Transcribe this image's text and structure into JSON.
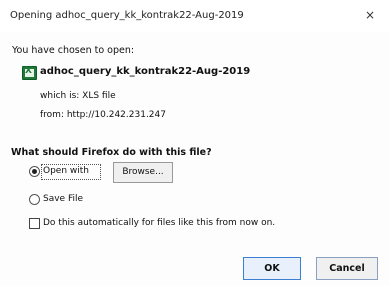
{
  "dialog": {
    "title": "Opening adhoc_query_kk_kontrak22-Aug-2019",
    "close_icon": "×"
  },
  "file": {
    "intro": "You have chosen to open:",
    "name": "adhoc_query_kk_kontrak22-Aug-2019",
    "which_is": "which is: XLS file",
    "from": "from: http://10.242.231.247",
    "icon": "xls-file-icon"
  },
  "action": {
    "question": "What should Firefox do with this file?",
    "open_with_label": "Open with",
    "browse_label": "Browse...",
    "save_file_label": "Save File",
    "selected": "open_with",
    "auto_label": "Do this automatically for files like this from now on.",
    "auto_checked": false
  },
  "buttons": {
    "ok": "OK",
    "cancel": "Cancel"
  }
}
